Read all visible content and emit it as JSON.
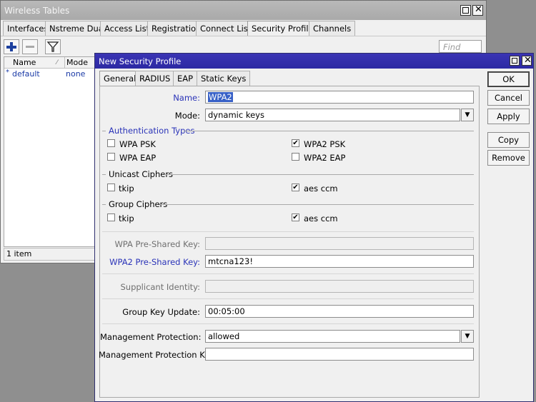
{
  "background_window": {
    "title": "Wireless Tables",
    "tabs": [
      "Interfaces",
      "Nstreme Dual",
      "Access List",
      "Registration",
      "Connect List",
      "Security Profiles",
      "Channels"
    ],
    "active_tab": "Security Profiles",
    "find_placeholder": "Find",
    "columns": [
      "Name",
      "Mode"
    ],
    "rows": [
      {
        "marker": "*",
        "name": "default",
        "mode": "none"
      }
    ],
    "status": "1 item"
  },
  "dialog": {
    "title": "New Security Profile",
    "tabs": [
      "General",
      "RADIUS",
      "EAP",
      "Static Keys"
    ],
    "active_tab": "General",
    "name_label": "Name:",
    "name_value": "WPA2",
    "mode_label": "Mode:",
    "mode_value": "dynamic keys",
    "auth_types_label": "Authentication Types",
    "auth": {
      "wpa_psk": {
        "label": "WPA PSK",
        "checked": false
      },
      "wpa2_psk": {
        "label": "WPA2 PSK",
        "checked": true
      },
      "wpa_eap": {
        "label": "WPA EAP",
        "checked": false
      },
      "wpa2_eap": {
        "label": "WPA2 EAP",
        "checked": false
      }
    },
    "unicast_label": "Unicast Ciphers",
    "unicast": {
      "tkip": {
        "label": "tkip",
        "checked": false
      },
      "aes_ccm": {
        "label": "aes ccm",
        "checked": true
      }
    },
    "group_label": "Group Ciphers",
    "group": {
      "tkip": {
        "label": "tkip",
        "checked": false
      },
      "aes_ccm": {
        "label": "aes ccm",
        "checked": true
      }
    },
    "wpa_psk_label": "WPA Pre-Shared Key:",
    "wpa_psk_value": "",
    "wpa2_psk_label": "WPA2 Pre-Shared Key:",
    "wpa2_psk_value": "mtcna123!",
    "supplicant_label": "Supplicant Identity:",
    "supplicant_value": "",
    "gku_label": "Group Key Update:",
    "gku_value": "00:05:00",
    "mgmt_prot_label": "Management Protection:",
    "mgmt_prot_value": "allowed",
    "mgmt_key_label": "Management Protection Key:",
    "mgmt_key_value": "",
    "buttons": {
      "ok": "OK",
      "cancel": "Cancel",
      "apply": "Apply",
      "copy": "Copy",
      "remove": "Remove"
    },
    "checkmark": "✔",
    "dropdown_glyph": "▼"
  },
  "colors": {
    "dialog_title_bar": "#2c29a3",
    "label_accent": "#2a33b8",
    "list_text": "#1a3aa6",
    "selection": "#3861c7"
  }
}
